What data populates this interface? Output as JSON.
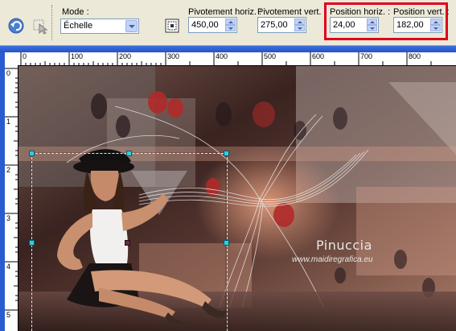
{
  "toolbar": {
    "undo_icon": "undo-icon",
    "tool_icon": "select-tool-icon",
    "mode": {
      "label": "Mode :",
      "value": "Échelle"
    },
    "pivot_icon": "pivot-icon",
    "pivot_h": {
      "label": "Pivotement horiz. :",
      "value": "450,00"
    },
    "pivot_v": {
      "label": "Pivotement vert. :",
      "value": "275,00"
    },
    "pos_h": {
      "label": "Position horiz. :",
      "value": "24,00"
    },
    "pos_v": {
      "label": "Position vert. :",
      "value": "182,00"
    },
    "highlight_color": "#e0001a"
  },
  "ruler": {
    "top_ticks": [
      "0",
      "100",
      "200",
      "300",
      "400",
      "500",
      "600",
      "700",
      "800"
    ],
    "left_ticks": [
      "0",
      "1",
      "2",
      "3",
      "4",
      "5"
    ]
  },
  "watermark": {
    "name": "Pinuccia",
    "site": "www.maidiregrafica.eu"
  },
  "colors": {
    "accent_blue": "#2453c6",
    "bg": "#ece9d8"
  }
}
